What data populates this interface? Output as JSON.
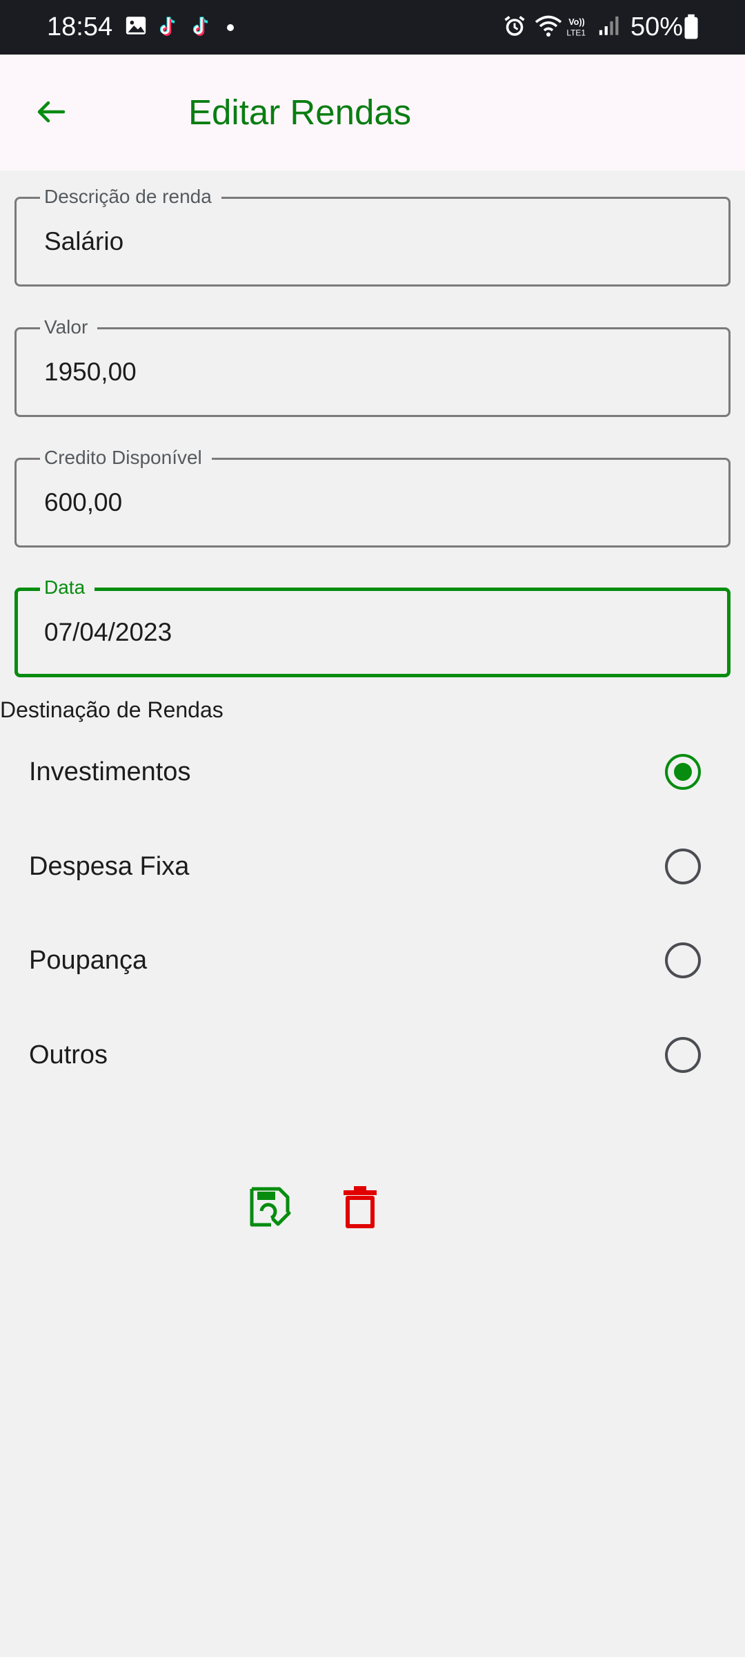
{
  "status_bar": {
    "time": "18:54",
    "battery": "50%",
    "icons": [
      "gallery-icon",
      "tiktok-icon",
      "tiktok-icon",
      "alarm-icon",
      "wifi-icon",
      "volte-icon",
      "signal-icon",
      "battery-icon"
    ]
  },
  "app_bar": {
    "title": "Editar Rendas",
    "back_icon": "arrow-left-icon"
  },
  "form": {
    "description": {
      "label": "Descrição de renda",
      "value": "Salário"
    },
    "value": {
      "label": "Valor",
      "value": "1950,00"
    },
    "credit": {
      "label": "Credito Disponível",
      "value": "600,00"
    },
    "date": {
      "label": "Data",
      "value": "07/04/2023"
    }
  },
  "destination": {
    "label": "Destinação de Rendas",
    "options": [
      {
        "label": "Investimentos",
        "selected": true
      },
      {
        "label": "Despesa Fixa",
        "selected": false
      },
      {
        "label": "Poupança",
        "selected": false
      },
      {
        "label": "Outros",
        "selected": false
      }
    ]
  },
  "actions": {
    "save_icon": "save-icon",
    "delete_icon": "trash-icon"
  },
  "colors": {
    "primary": "#078c0f",
    "delete": "#e10000",
    "status_bar": "#1a1c22",
    "app_bar": "#fdf7fb",
    "background": "#f1f1f1"
  }
}
